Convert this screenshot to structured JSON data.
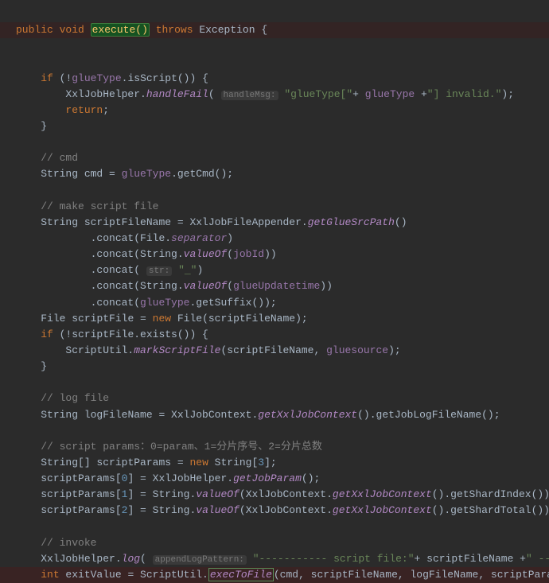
{
  "line1": {
    "kw1": "public",
    "kw2": "void",
    "method": "execute()",
    "kw3": "throws",
    "ex": "Exception",
    "brace": "{"
  },
  "line3": {
    "kw": "if",
    "open": "(!",
    "field": "glueType",
    "call": ".isScript()) {"
  },
  "line4": {
    "cls": "XxlJobHelper",
    "dot": ".",
    "m": "handleFail",
    "op": "(",
    "hint": "handleMsg:",
    "s1": "\"glueType[\"",
    "plus": "+ ",
    "f": "glueType",
    "plus2": " +",
    "s2": "\"] invalid.\"",
    "close": ");"
  },
  "line5": {
    "kw": "return",
    ";": ";"
  },
  "line6": {
    "brace": "}"
  },
  "line8": {
    "c": "// cmd"
  },
  "line9": {
    "t": "String",
    "n": " cmd = ",
    "f": "glueType",
    "m": ".getCmd();"
  },
  "line11": {
    "c": "// make script file"
  },
  "line12": {
    "t": "String",
    "n": " scriptFileName = XxlJobFileAppender.",
    "m": "getGlueSrcPath",
    "p": "()"
  },
  "line13": {
    "m": ".concat",
    "open": "(File.",
    "c": "separator",
    "close": ")"
  },
  "line14": {
    "m": ".concat",
    "open": "(String.",
    "sm": "valueOf",
    "op2": "(",
    "f": "jobId",
    "close": "))"
  },
  "line15": {
    "m": ".concat",
    "open": "(",
    "hint": "str:",
    "s": "\"_\"",
    "close": ")"
  },
  "line16": {
    "m": ".concat",
    "open": "(String.",
    "sm": "valueOf",
    "op2": "(",
    "f": "glueUpdatetime",
    "close": "))"
  },
  "line17": {
    "m": ".concat",
    "open": "(",
    "f": "glueType",
    "call": ".getSuffix());"
  },
  "line18": {
    "t": "File",
    "n": " scriptFile = ",
    "kw": "new",
    "n2": " File(scriptFileName);"
  },
  "line19": {
    "kw": "if",
    "txt": " (!scriptFile.exists()) {"
  },
  "line20": {
    "cls": "ScriptUtil.",
    "m": "markScriptFile",
    "args": "(scriptFileName, ",
    "f": "gluesource",
    "close": ");"
  },
  "line21": {
    "brace": "}"
  },
  "line23": {
    "c": "// log file"
  },
  "line24": {
    "t": "String",
    "n": " logFileName = XxlJobContext.",
    "m": "getXxlJobContext",
    "p": "().getJobLogFileName();"
  },
  "line26": {
    "c": "// script params：0=param、1=分片序号、2=分片总数"
  },
  "line27": {
    "t": "String",
    "arr": "[] scriptParams = ",
    "kw": "new",
    "t2": " String",
    "idx": "[",
    "num": "3",
    "close": "];"
  },
  "line28": {
    "n": "scriptParams[",
    "num": "0",
    "mid": "] = XxlJobHelper.",
    "m": "getJobParam",
    "p": "();"
  },
  "line29": {
    "n": "scriptParams[",
    "num": "1",
    "mid": "] = String.",
    "m": "valueOf",
    "op": "(XxlJobContext.",
    "m2": "getXxlJobContext",
    "p": "().getShardIndex());"
  },
  "line30": {
    "n": "scriptParams[",
    "num": "2",
    "mid": "] = String.",
    "m": "valueOf",
    "op": "(XxlJobContext.",
    "m2": "getXxlJobContext",
    "p": "().getShardTotal());"
  },
  "line32": {
    "c": "// invoke"
  },
  "line33": {
    "cls": "XxlJobHelper.",
    "m": "log",
    "op": "(",
    "hint": "appendLogPattern:",
    "s1": "\"----------- script file:\"",
    "plus": "+ scriptFileName +",
    "s2": "\" -----------\"",
    "close": ");"
  },
  "line34": {
    "t": "int",
    "n": " exitValue = ScriptUtil.",
    "m": "execToFile",
    "args": "(cmd, scriptFileName, logFileName, scriptParams);"
  }
}
